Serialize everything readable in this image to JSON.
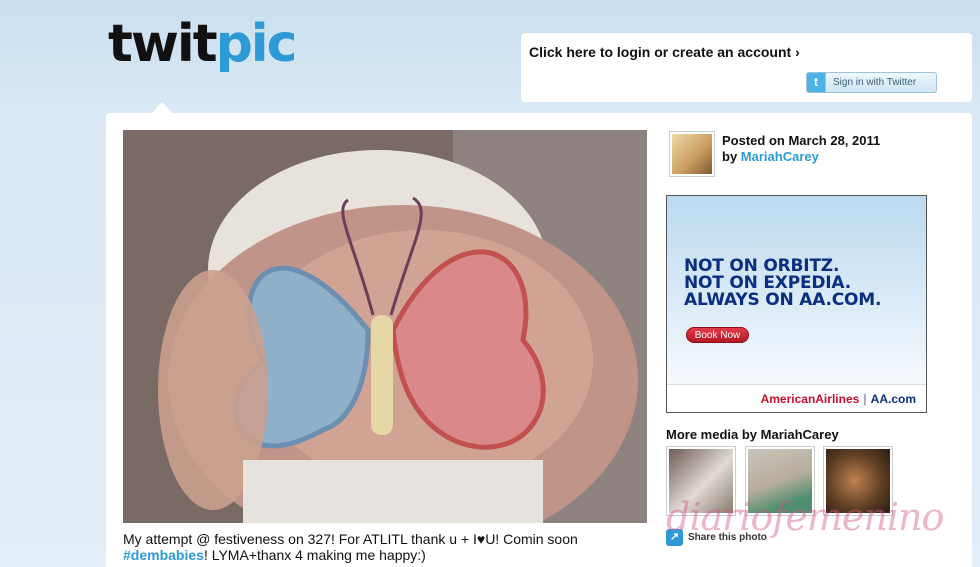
{
  "logo": {
    "part1": "twit",
    "part2": "pic"
  },
  "header": {
    "login_link": "Click here to login or create an account ›",
    "twitter_button": {
      "icon": "t",
      "label": "Sign in with Twitter"
    }
  },
  "photo": {
    "caption_text": "My attempt @ festiveness on 327! For ATLITL thank u + I♥U! Comin soon ",
    "hashtag": "#dembabies",
    "caption_rest": "! LYMA+thanx 4 making me happy:)"
  },
  "meta": {
    "posted_label": "Posted on March 28, 2011",
    "by_label": "by",
    "username": "MariahCarey"
  },
  "ad": {
    "line1": "NOT ON ORBITZ.",
    "line2": "NOT ON EXPEDIA.",
    "line3": "ALWAYS ON AA.COM.",
    "button": "Book Now",
    "brand": "AmericanAirlines",
    "separator": "|",
    "url": "AA.com"
  },
  "more_media": {
    "title": "More media by MariahCarey"
  },
  "share": {
    "icon": "↗",
    "label": "Share this photo"
  },
  "watermark": "diariofemenino",
  "colors": {
    "accent": "#2d9ad6",
    "ad_navy": "#0a2f80",
    "ad_red": "#c8102e"
  }
}
